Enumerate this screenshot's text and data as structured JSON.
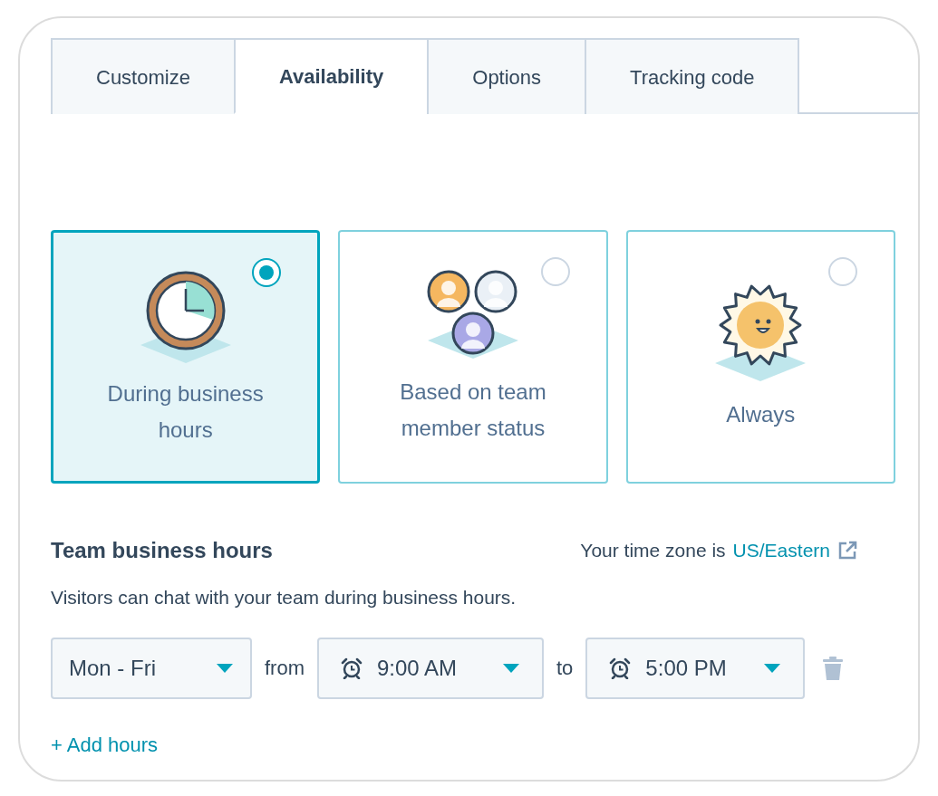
{
  "tabs": [
    {
      "label": "Customize",
      "selected": false
    },
    {
      "label": "Availability",
      "selected": true
    },
    {
      "label": "Options",
      "selected": false
    },
    {
      "label": "Tracking code",
      "selected": false
    }
  ],
  "availability_options": [
    {
      "label": "During business hours",
      "kind": "clock",
      "selected": true
    },
    {
      "label": "Based on team member status",
      "kind": "people",
      "selected": false
    },
    {
      "label": "Always",
      "kind": "sun",
      "selected": false
    }
  ],
  "business_hours": {
    "title": "Team business hours",
    "time_zone_prefix": "Your time zone is",
    "time_zone": "US/Eastern",
    "description": "Visitors can chat with your team during business hours.",
    "rows": [
      {
        "days": "Mon - Fri",
        "from_label": "from",
        "start": "9:00 AM",
        "to_label": "to",
        "end": "5:00 PM"
      }
    ],
    "add_label": "+ Add hours"
  }
}
